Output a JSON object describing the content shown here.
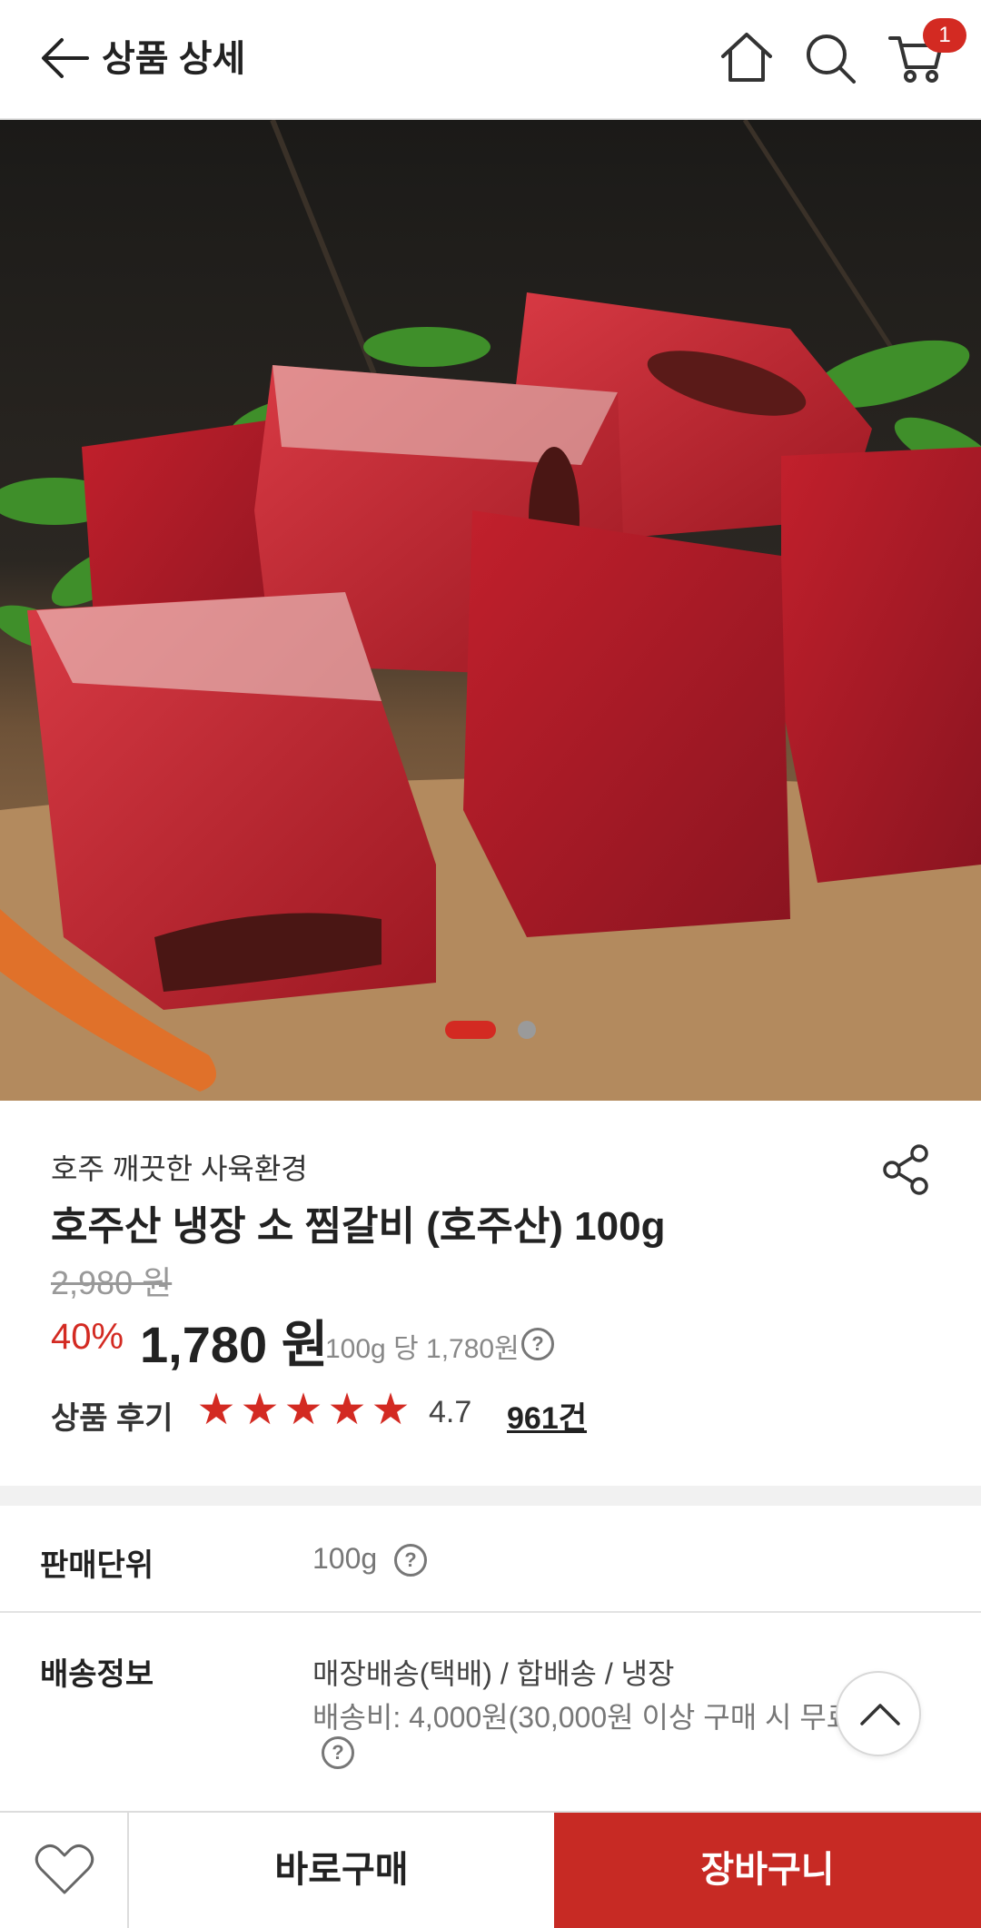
{
  "header": {
    "title": "상품 상세",
    "cart_count": "1"
  },
  "product": {
    "brand": "호주 깨끗한 사육환경",
    "name": "호주산 냉장 소 찜갈비 (호주산) 100g",
    "original_price": "2,980 원",
    "discount": "40%",
    "price": "1,780 원",
    "unit_price": "100g 당 1,780원",
    "review_label": "상품 후기",
    "rating": "4.7",
    "rating_value": 4.7,
    "review_count": "961건",
    "image_slides": 2,
    "active_slide": 1
  },
  "info": {
    "unit_label": "판매단위",
    "unit_value": "100g",
    "delivery_label": "배송정보",
    "delivery_value": "매장배송(택배) / 합배송 / 냉장",
    "delivery_fee": "배송비: 4,000원(30,000원 이상 구매 시 무료"
  },
  "footer": {
    "buy_now": "바로구매",
    "add_cart": "장바구니"
  },
  "colors": {
    "accent": "#d32a22",
    "button": "#c72a24"
  }
}
